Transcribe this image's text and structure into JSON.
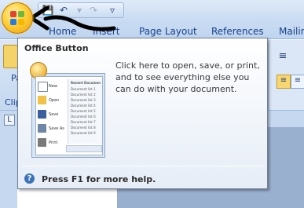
{
  "tabs": [
    "Home",
    "Insert",
    "Page Layout",
    "References",
    "Mailin"
  ],
  "office_button_icon": "office-logo-icon",
  "quick_access": [
    "save-icon",
    "undo-icon",
    "redo-icon",
    "customize-dropdown-icon"
  ],
  "tooltip": {
    "title": "Office Button",
    "description": "Click here to open, save, or print, and to see everything else you can do with your document.",
    "help_text": "Press F1 for more help."
  },
  "ribbon_left": {
    "paste_partial": "Pa",
    "clipboard_partial": "Clip"
  },
  "thumbnail": {
    "menu_items": [
      "New",
      "Open",
      "Save",
      "Save As",
      "Print"
    ],
    "recent_header": "Recent Documents",
    "recent_items": [
      "Document list 1",
      "Document list 2",
      "Document list 3",
      "Document list 4",
      "Document list 5",
      "Document list 6",
      "Document list 7",
      "Document list 8",
      "Document list 9"
    ]
  },
  "colors": {
    "ribbon": "#c4d8f0",
    "tab_text": "#15428b",
    "accent": "#e79a0c"
  }
}
